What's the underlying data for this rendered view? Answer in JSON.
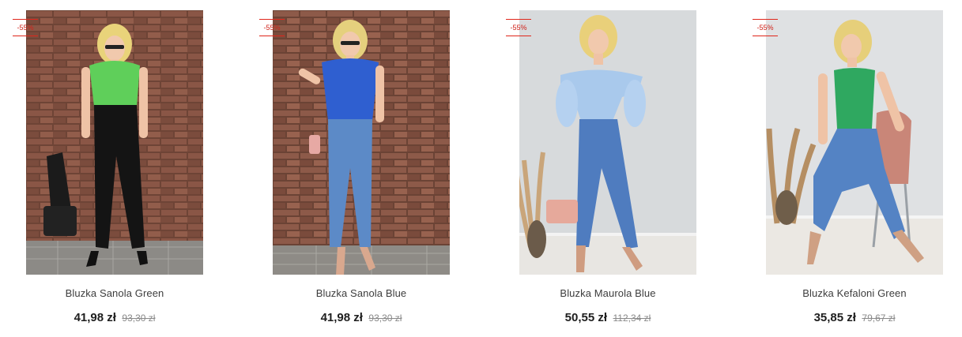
{
  "products": [
    {
      "name": "Bluzka Sanola Green",
      "price": "41,98 zł",
      "old_price": "93,30 zł",
      "discount": "-55%",
      "photo": "brick-wall-green-top",
      "top_color": "#5fcf5a",
      "bottom_color": "#141414"
    },
    {
      "name": "Bluzka Sanola Blue",
      "price": "41,98 zł",
      "old_price": "93,30 zł",
      "discount": "-55%",
      "photo": "brick-wall-blue-top",
      "top_color": "#2f5fd0",
      "bottom_color": "#5c8ac7"
    },
    {
      "name": "Bluzka Maurola Blue",
      "price": "50,55 zł",
      "old_price": "112,34 zł",
      "discount": "-55%",
      "photo": "studio-light-blue-top",
      "top_color": "#a9c9ec",
      "bottom_color": "#4f7cbf"
    },
    {
      "name": "Bluzka Kefaloni Green",
      "price": "35,85 zł",
      "old_price": "79,67 zł",
      "discount": "-55%",
      "photo": "studio-green-top-chair",
      "top_color": "#2fa860",
      "bottom_color": "#5483c4"
    }
  ]
}
